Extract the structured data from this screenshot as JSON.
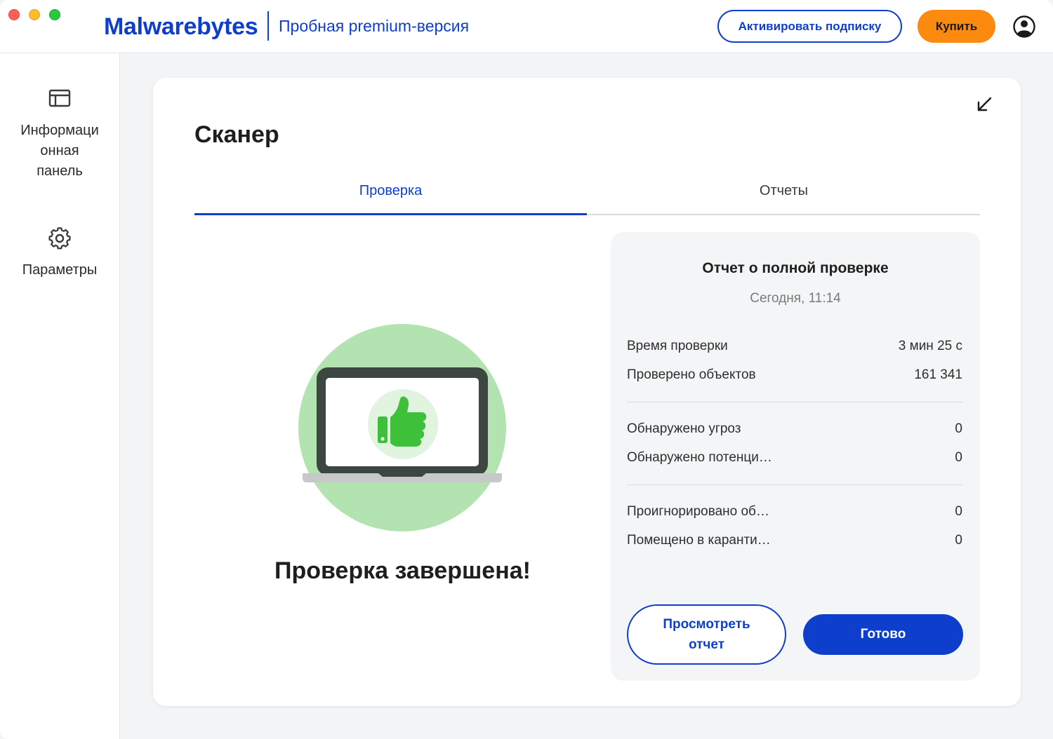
{
  "window": {
    "traffic_lights": [
      "close",
      "minimize",
      "zoom"
    ]
  },
  "header": {
    "logo_text": "Malwarebytes",
    "trial_label": "Пробная premium-версия",
    "activate_label": "Активировать подписку",
    "buy_label": "Купить",
    "account_icon": "account-icon",
    "colors": {
      "brand_blue": "#0d3ecc",
      "buy_orange": "#fc8a0f"
    }
  },
  "sidebar": {
    "items": [
      {
        "label": "Информационная панель",
        "label_lines": [
          "Информаци",
          "онная",
          "панель"
        ],
        "icon": "dashboard-icon"
      },
      {
        "label": "Параметры",
        "icon": "gear-icon"
      }
    ]
  },
  "scanner": {
    "title": "Сканер",
    "tabs": [
      {
        "label": "Проверка",
        "active": true
      },
      {
        "label": "Отчеты",
        "active": false
      }
    ],
    "status_text": "Проверка завершена!",
    "illustration_icon": "laptop-thumbs-up-icon",
    "report": {
      "title": "Отчет о полной проверке",
      "date": "Сегодня, 11:14",
      "rows": [
        {
          "label": "Время проверки",
          "value": "3 мин 25 с"
        },
        {
          "label": "Проверено объектов",
          "value": "161 341"
        },
        {
          "label": "Обнаружено угроз",
          "value": "0"
        },
        {
          "label": "Обнаружено потенци…",
          "value": "0"
        },
        {
          "label": "Проигнорировано об…",
          "value": "0"
        },
        {
          "label": "Помещено в каранти…",
          "value": "0"
        }
      ],
      "view_report_label": "Просмотреть отчет",
      "done_label": "Готово"
    }
  }
}
